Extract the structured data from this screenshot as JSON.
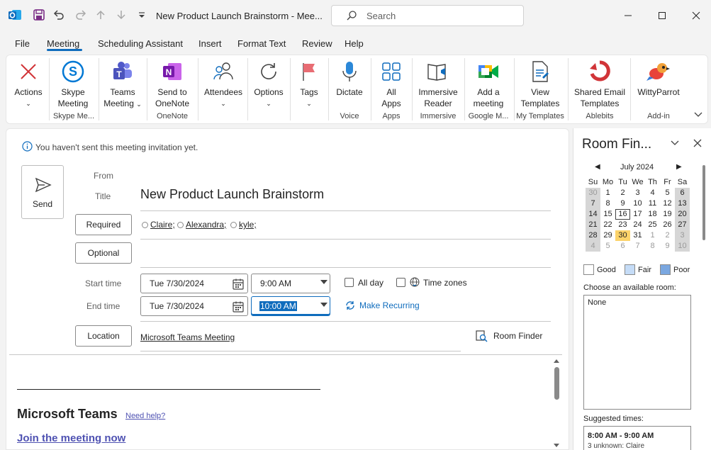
{
  "window": {
    "title": "New Product Launch Brainstorm  -  Mee..."
  },
  "search": {
    "label": "Search"
  },
  "menu": {
    "items": [
      "File",
      "Meeting",
      "Scheduling Assistant",
      "Insert",
      "Format Text",
      "Review",
      "Help"
    ]
  },
  "ribbon": {
    "actions": "Actions",
    "skype": [
      "Skype",
      "Meeting"
    ],
    "skype_group": "Skype Me...",
    "teams": [
      "Teams",
      "Meeting"
    ],
    "onenote": [
      "Send to",
      "OneNote"
    ],
    "onenote_group": "OneNote",
    "attendees": "Attendees",
    "options": "Options",
    "tags": "Tags",
    "dictate": "Dictate",
    "voice_group": "Voice",
    "allapps": [
      "All",
      "Apps"
    ],
    "apps_group": "Apps",
    "immersive": [
      "Immersive",
      "Reader"
    ],
    "immersive_group": "Immersive",
    "addmeeting": [
      "Add a",
      "meeting"
    ],
    "google_group": "Google M...",
    "viewtemplates": [
      "View",
      "Templates"
    ],
    "templates_group": "My Templates",
    "sharedemail": [
      "Shared Email",
      "Templates"
    ],
    "ablebits_group": "Ablebits",
    "witty": "WittyParrot",
    "addin_group": "Add-in"
  },
  "form": {
    "info": "You haven't sent this meeting invitation yet.",
    "send": "Send",
    "from_label": "From",
    "title_label": "Title",
    "title_value": "New Product Launch Brainstorm",
    "required": "Required",
    "optional": "Optional",
    "attendees": [
      "Claire;",
      "Alexandra;",
      "kyle;"
    ],
    "start_label": "Start time",
    "end_label": "End time",
    "start_date": "Tue 7/30/2024",
    "start_time": "9:00 AM",
    "end_date": "Tue 7/30/2024",
    "end_time": "10:00 AM",
    "allday": "All day",
    "timezones": "Time zones",
    "recurring": "Make Recurring",
    "location_btn": "Location",
    "location_value": "Microsoft Teams Meeting",
    "roomfinder": "Room Finder"
  },
  "body": {
    "teams_heading": "Microsoft Teams",
    "need_help": "Need help?",
    "join": "Join the meeting now"
  },
  "pane": {
    "title": "Room Fin...",
    "month": "July 2024",
    "weekdays": [
      "Su",
      "Mo",
      "Tu",
      "We",
      "Th",
      "Fr",
      "Sa"
    ],
    "weeks": [
      [
        "30",
        "1",
        "2",
        "3",
        "4",
        "5",
        "6"
      ],
      [
        "7",
        "8",
        "9",
        "10",
        "11",
        "12",
        "13"
      ],
      [
        "14",
        "15",
        "16",
        "17",
        "18",
        "19",
        "20"
      ],
      [
        "21",
        "22",
        "23",
        "24",
        "25",
        "26",
        "27"
      ],
      [
        "28",
        "29",
        "30",
        "31",
        "1",
        "2",
        "3"
      ],
      [
        "4",
        "5",
        "6",
        "7",
        "8",
        "9",
        "10"
      ]
    ],
    "legend": {
      "good": "Good",
      "fair": "Fair",
      "poor": "Poor"
    },
    "colors": {
      "good": "#ffffff",
      "fair": "#c5dcf7",
      "poor": "#7aa7e0"
    },
    "choose_label": "Choose an available room:",
    "room_none": "None",
    "suggested_label": "Suggested times:",
    "suggested_time": "8:00 AM - 9:00 AM",
    "suggested_sub": "3 unknown: Claire"
  }
}
